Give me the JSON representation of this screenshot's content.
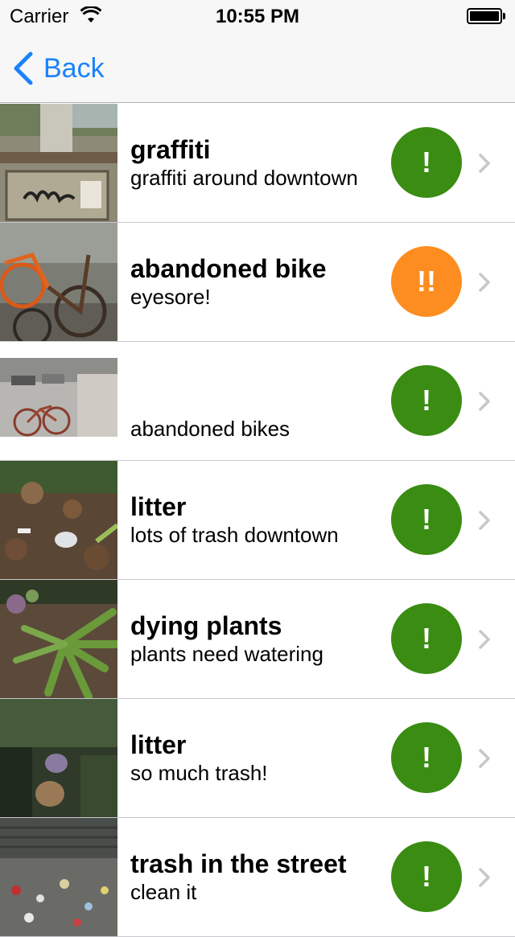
{
  "status_bar": {
    "carrier": "Carrier",
    "time": "10:55 PM"
  },
  "nav": {
    "back_label": "Back",
    "back_icon": "chevron-left-icon"
  },
  "colors": {
    "accent": "#1a82fb",
    "green_badge": "#3a8c12",
    "orange_badge": "#fd8d20",
    "chevron": "#c7c7cc"
  },
  "items": [
    {
      "title": "graffiti",
      "subtitle": "graffiti around downtown",
      "badge": "!",
      "badge_color": "#3a8c12"
    },
    {
      "title": "abandoned bike",
      "subtitle": "eyesore!",
      "badge": "!!",
      "badge_color": "#fd8d20"
    },
    {
      "title": "",
      "subtitle": "abandoned bikes",
      "badge": "!",
      "badge_color": "#3a8c12"
    },
    {
      "title": "litter",
      "subtitle": "lots of trash downtown",
      "badge": "!",
      "badge_color": "#3a8c12"
    },
    {
      "title": "dying plants",
      "subtitle": "plants need watering",
      "badge": "!",
      "badge_color": "#3a8c12"
    },
    {
      "title": "litter",
      "subtitle": "so much trash!",
      "badge": "!",
      "badge_color": "#3a8c12"
    },
    {
      "title": "trash in the street",
      "subtitle": "clean it",
      "badge": "!",
      "badge_color": "#3a8c12"
    }
  ]
}
